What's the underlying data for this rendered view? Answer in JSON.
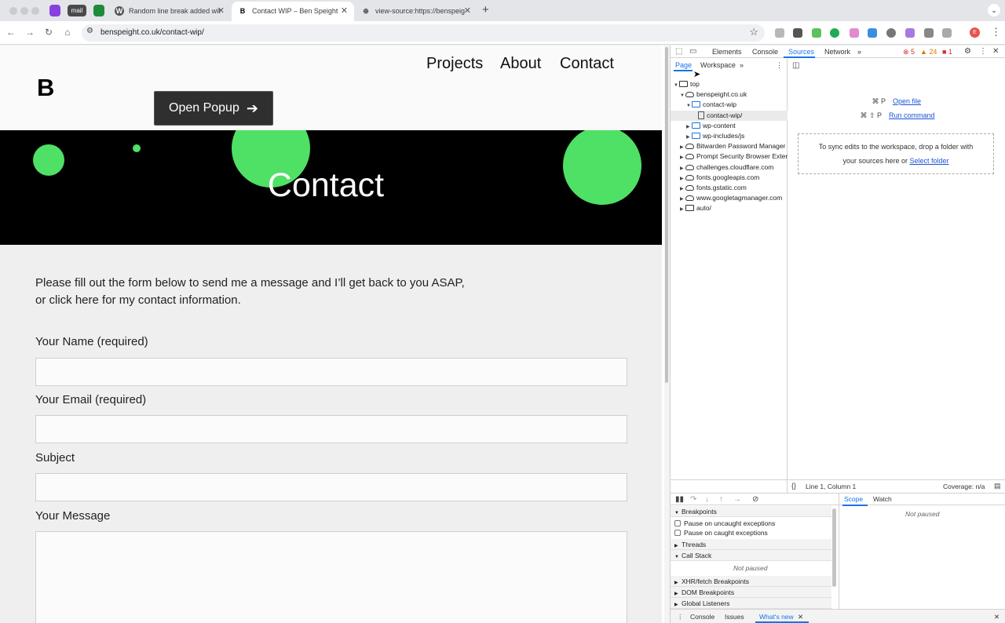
{
  "browser": {
    "pinned": [
      {
        "label": "",
        "color": "#8a3fe0"
      },
      {
        "label": "mail",
        "color": "#4a4a4a"
      },
      {
        "label": "",
        "color": "#1f8a3b"
      }
    ],
    "tabs": [
      {
        "title": "Random line break added wit",
        "favicon": "W"
      },
      {
        "title": "Contact WIP – Ben Speight",
        "favicon": "B"
      },
      {
        "title": "view-source:https://benspeig",
        "favicon": "⊕"
      }
    ],
    "new_tab": "+",
    "url": "benspeight.co.uk/contact-wip/",
    "profile_initial": "E"
  },
  "site": {
    "logo": "B",
    "nav": [
      "Projects",
      "About",
      "Contact"
    ],
    "popup_button": "Open Popup",
    "hero_title": "Contact",
    "intro_line1": "Please fill out the form below to send me a message and I’ll get back to you ASAP,",
    "intro_line2": "or click here for my contact information.",
    "form": {
      "name_label": "Your Name (required)",
      "email_label": "Your Email (required)",
      "subject_label": "Subject",
      "message_label": "Your Message",
      "name_value": "",
      "email_value": "",
      "subject_value": "",
      "message_value": ""
    },
    "accent_color": "#4fe066"
  },
  "devtools": {
    "tabs": [
      "Elements",
      "Console",
      "Sources",
      "Network"
    ],
    "selected_tab": "Sources",
    "errors": "5",
    "warnings": "24",
    "issues": "1",
    "subtabs": [
      "Page",
      "Workspace"
    ],
    "tree": [
      {
        "label": "top",
        "icon": "frame",
        "level": 0,
        "open": true
      },
      {
        "label": "benspeight.co.uk",
        "icon": "cloud",
        "level": 1,
        "open": true
      },
      {
        "label": "contact-wip",
        "icon": "folder",
        "level": 2,
        "open": true
      },
      {
        "label": "contact-wip/",
        "icon": "file",
        "level": 3,
        "open": null
      },
      {
        "label": "wp-content",
        "icon": "folder",
        "level": 2,
        "open": false
      },
      {
        "label": "wp-includes/js",
        "icon": "folder",
        "level": 2,
        "open": false
      },
      {
        "label": "Bitwarden Password Manager",
        "icon": "cloud",
        "level": 1,
        "open": false
      },
      {
        "label": "Prompt Security Browser Exter",
        "icon": "cloud",
        "level": 1,
        "open": false
      },
      {
        "label": "challenges.cloudflare.com",
        "icon": "cloud",
        "level": 1,
        "open": false
      },
      {
        "label": "fonts.googleapis.com",
        "icon": "cloud",
        "level": 1,
        "open": false
      },
      {
        "label": "fonts.gstatic.com",
        "icon": "cloud",
        "level": 1,
        "open": false
      },
      {
        "label": "www.googletagmanager.com",
        "icon": "cloud",
        "level": 1,
        "open": false
      },
      {
        "label": "auto/",
        "icon": "frame",
        "level": 1,
        "open": false
      }
    ],
    "open_file_shortcut": "⌘ P",
    "open_file": "Open file",
    "run_command_shortcut": "⌘ ⇧ P",
    "run_command": "Run command",
    "workspace_hint_1": "To sync edits to the workspace, drop a folder with",
    "workspace_hint_2": "your sources here or",
    "select_folder": "Select folder",
    "cursor_position": "Line 1, Column 1",
    "coverage": "Coverage: n/a",
    "debugger": {
      "breakpoints": "Breakpoints",
      "pause_uncaught": "Pause on uncaught exceptions",
      "pause_caught": "Pause on caught exceptions",
      "threads": "Threads",
      "call_stack": "Call Stack",
      "not_paused": "Not paused",
      "xhr": "XHR/fetch Breakpoints",
      "dom": "DOM Breakpoints",
      "global": "Global Listeners",
      "scope": "Scope",
      "watch": "Watch"
    },
    "drawer": [
      "Console",
      "Issues",
      "What's new"
    ]
  }
}
